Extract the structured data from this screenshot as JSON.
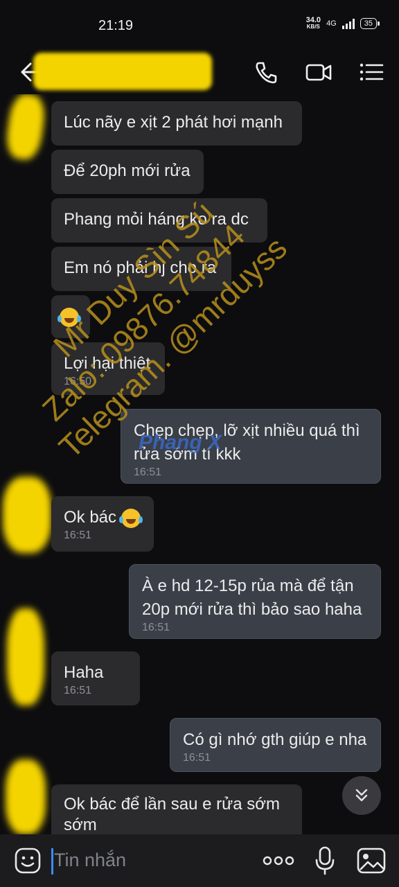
{
  "status": {
    "time": "21:19",
    "net_speed": "34.0",
    "net_unit": "KB/S",
    "network": "4G",
    "battery": "35"
  },
  "header": {
    "contact_name": ""
  },
  "messages": [
    {
      "dir": "in",
      "text": "Lúc nãy e xịt 2 phát hơi mạnh",
      "time": ""
    },
    {
      "dir": "in",
      "text": "Để 20ph mới rửa",
      "time": ""
    },
    {
      "dir": "in",
      "text": "Phang mỏi háng ko ra dc",
      "time": ""
    },
    {
      "dir": "in",
      "text": "Em nó phải hj cho ra",
      "time": ""
    },
    {
      "dir": "in",
      "text": "",
      "emoji": "tears-of-joy",
      "time": ""
    },
    {
      "dir": "in",
      "text": "Lợi hại thiệt",
      "time": "16:50"
    },
    {
      "dir": "out",
      "text": "Chẹp chẹp, lỡ xịt nhiều quá thì rửa sớm tí kkk",
      "time": "16:51"
    },
    {
      "dir": "in",
      "text": "Ok bác",
      "emoji": "tears-of-joy",
      "time": "16:51"
    },
    {
      "dir": "out",
      "text": "À e hd 12-15p rủa mà để tận 20p mới rửa thì bảo sao haha",
      "time": "16:51"
    },
    {
      "dir": "in",
      "text": "Haha",
      "time": "16:51"
    },
    {
      "dir": "out",
      "text": "Có gì nhớ gth giúp e nha",
      "time": "16:51"
    },
    {
      "dir": "in",
      "text": "Ok bác để lần sau e rửa sớm sớm",
      "time": ""
    }
  ],
  "watermark": {
    "line1": "Mr Duy Sìn Sú",
    "line2": "Zalo: 09876.74844",
    "line3": "Telegram. @mrduyss",
    "logo": "Phang X",
    "color": "#b8901c"
  },
  "composer": {
    "placeholder": "Tin nhắn"
  },
  "colors": {
    "accent": "#3d8cff",
    "bubble_in": "#2b2b2d",
    "bubble_out": "#3a3f48",
    "redaction": "#f4d400"
  }
}
